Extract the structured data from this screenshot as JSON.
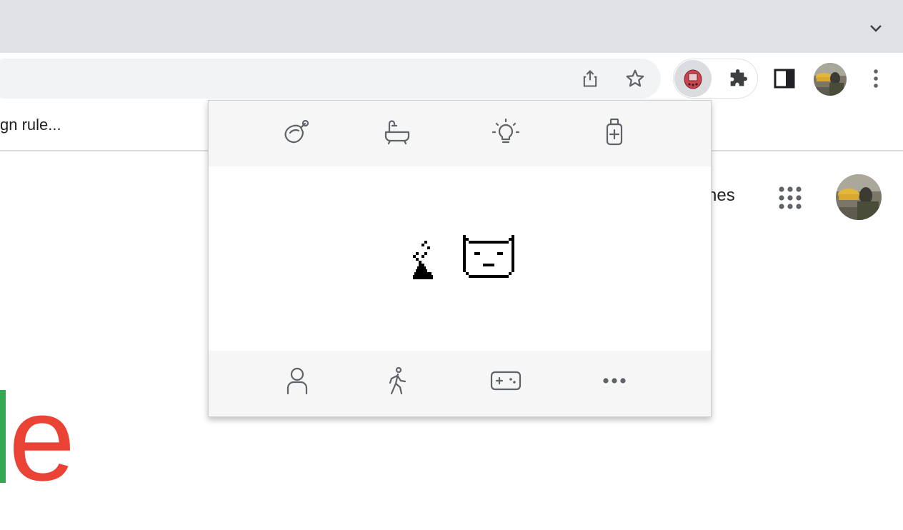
{
  "browser": {
    "bookmarks_bar": {
      "visible_text": "gn rule..."
    },
    "toolbar_icons": [
      "share-icon",
      "bookmark-star-icon",
      "tamagotchi-extension-icon",
      "extensions-puzzle-icon",
      "side-panel-icon",
      "profile-avatar",
      "more-vert-icon"
    ],
    "colors": {
      "tabstrip": "#dfe1e5",
      "omnibox": "#f1f3f4",
      "extension_active_bg": "#dadce0"
    }
  },
  "page": {
    "partial_link": "nes",
    "logo_letter": "e",
    "colors": {
      "logo_red": "#ea4335",
      "logo_green": "#34a853"
    }
  },
  "popup": {
    "top_actions": [
      "feed-icon",
      "bath-icon",
      "light-icon",
      "medicine-icon"
    ],
    "bottom_actions": [
      "profile-icon",
      "walk-icon",
      "game-icon",
      "more-icon"
    ],
    "pet_scene": [
      "poop-sprite",
      "cat-pet-sprite"
    ],
    "colors": {
      "panel_bg": "#f6f6f6",
      "icon": "#5f6368",
      "pixel": "#000000"
    }
  }
}
